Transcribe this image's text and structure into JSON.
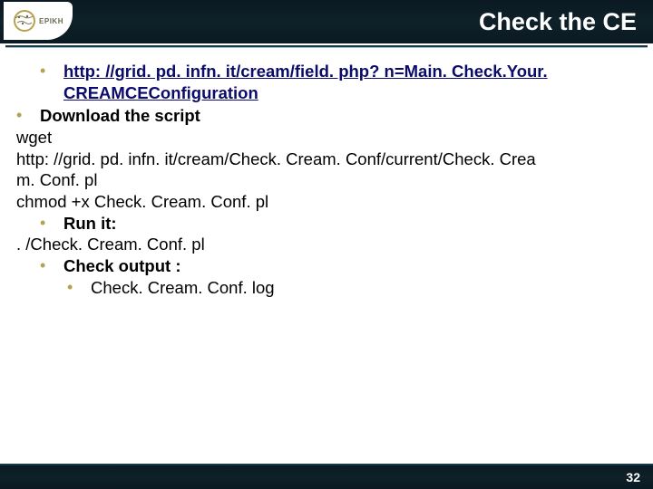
{
  "header": {
    "logo_text": "EPIKH",
    "title": "Check the CE"
  },
  "content": {
    "link": "http: //grid. pd. infn. it/cream/field. php? n=Main. Check.Your. CREAMCEConfiguration",
    "b1": "Download the script",
    "l1": "wget",
    "l2": "http: //grid. pd. infn. it/cream/Check. Cream. Conf/current/Check. Crea",
    "l3": "m. Conf. pl",
    "l4": "chmod +x Check. Cream. Conf. pl",
    "b2": "Run it:",
    "l5": ". /Check. Cream. Conf. pl",
    "b3": "Check output :",
    "b4": "Check. Cream. Conf. log"
  },
  "footer": {
    "page": "32"
  }
}
